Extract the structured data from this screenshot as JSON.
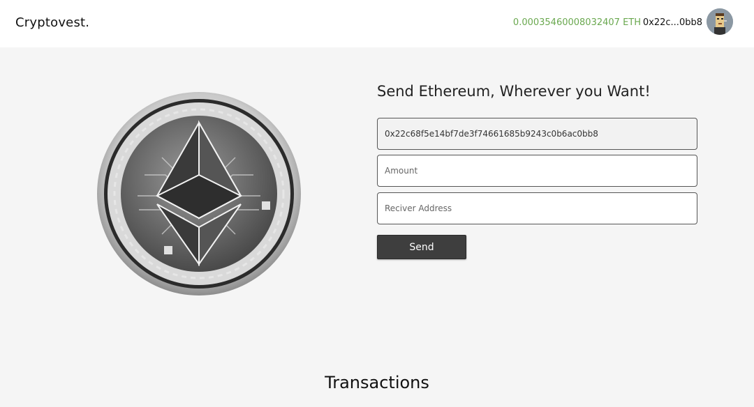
{
  "navbar": {
    "brand": "Cryptovest.",
    "balance": "0.00035460008032407 ETH",
    "account_short": "0x22c...0bb8"
  },
  "hero": {
    "coin_icon": "ethereum-coin-icon"
  },
  "send_form": {
    "title": "Send Ethereum, Wherever you Want!",
    "sender_address": "0x22c68f5e14bf7de3f74661685b9243c0b6ac0bb8",
    "amount_placeholder": "Amount",
    "receiver_placeholder": "Reciver Address",
    "send_label": "Send"
  },
  "transactions": {
    "title": "Transactions"
  },
  "colors": {
    "balance": "#6aa84f",
    "button": "#3e3e3e",
    "background": "#f5f5f5"
  }
}
